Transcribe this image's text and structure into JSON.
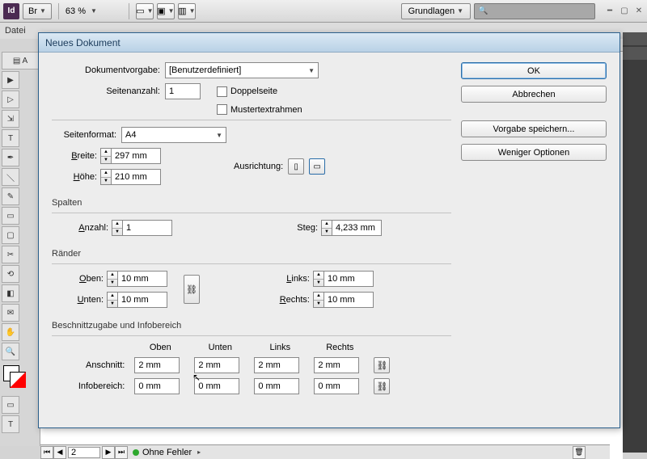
{
  "app_bar": {
    "br": "Br",
    "id": "Id",
    "zoom": "63 %",
    "workspace": "Grundlagen",
    "search_placeholder": " "
  },
  "menu": {
    "file": "Datei"
  },
  "status": {
    "page": "2",
    "errors": "Ohne Fehler"
  },
  "dialog": {
    "title": "Neues Dokument",
    "buttons": {
      "ok": "OK",
      "cancel": "Abbrechen",
      "save_preset": "Vorgabe speichern...",
      "fewer": "Weniger Optionen"
    },
    "labels": {
      "doc_preset": "Dokumentvorgabe:",
      "pages": "Seitenanzahl:",
      "facing": "Doppelseite",
      "master": "Mustertextrahmen",
      "page_size": "Seitenformat:",
      "width": "Breite:",
      "height": "Höhe:",
      "orientation": "Ausrichtung:",
      "columns": "Spalten",
      "col_count": "Anzahl:",
      "gutter": "Steg:",
      "margins": "Ränder",
      "top": "Oben:",
      "bottom": "Unten:",
      "left": "Links:",
      "right": "Rechts:",
      "bleed_area": "Beschnittzugabe und Infobereich",
      "col_top": "Oben",
      "col_bottom": "Unten",
      "col_left": "Links",
      "col_right": "Rechts",
      "bleed": "Anschnitt:",
      "slug": "Infobereich:"
    },
    "values": {
      "doc_preset": "[Benutzerdefiniert]",
      "pages": "1",
      "page_size": "A4",
      "width": "297 mm",
      "height": "210 mm",
      "col_count": "1",
      "gutter": "4,233 mm",
      "margin_top": "10 mm",
      "margin_bottom": "10 mm",
      "margin_left": "10 mm",
      "margin_right": "10 mm",
      "bleed_top": "2 mm",
      "bleed_bottom": "2 mm",
      "bleed_left": "2 mm",
      "bleed_right": "2 mm",
      "slug_top": "0 mm",
      "slug_bottom": "0 mm",
      "slug_left": "0 mm",
      "slug_right": "0 mm"
    }
  }
}
